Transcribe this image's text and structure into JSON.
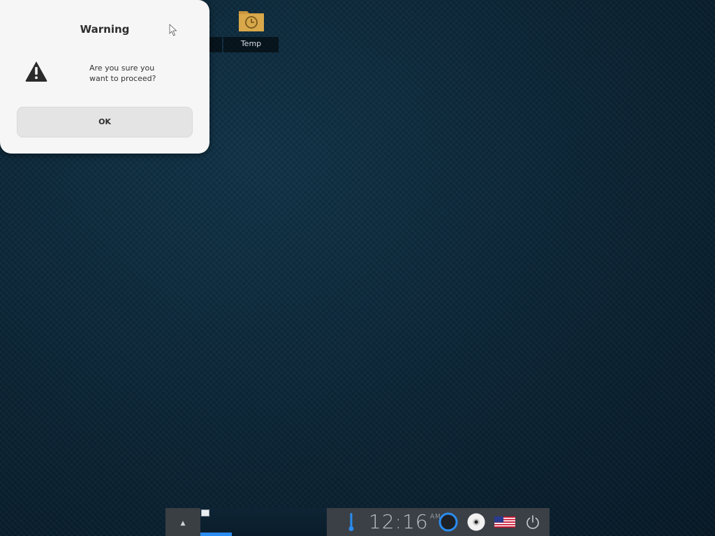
{
  "dialog": {
    "title": "Warning",
    "message_line1": "Are you sure you",
    "message_line2": "want to proceed?",
    "ok_label": "OK",
    "icon": "warning-triangle-icon"
  },
  "desktop": {
    "icons": [
      {
        "label": "Temp",
        "icon": "folder-clock-icon",
        "color": "#d8a84a"
      }
    ]
  },
  "taskbar": {
    "up_icon": "chevron-up-icon",
    "up_glyph": "▲",
    "clock": {
      "time": "12:16",
      "ampm": "AM"
    },
    "tray_icons": [
      "thermometer-icon",
      "circle-icon",
      "disc-icon",
      "us-flag-icon",
      "power-icon"
    ],
    "accent_color": "#2a8cf0"
  }
}
